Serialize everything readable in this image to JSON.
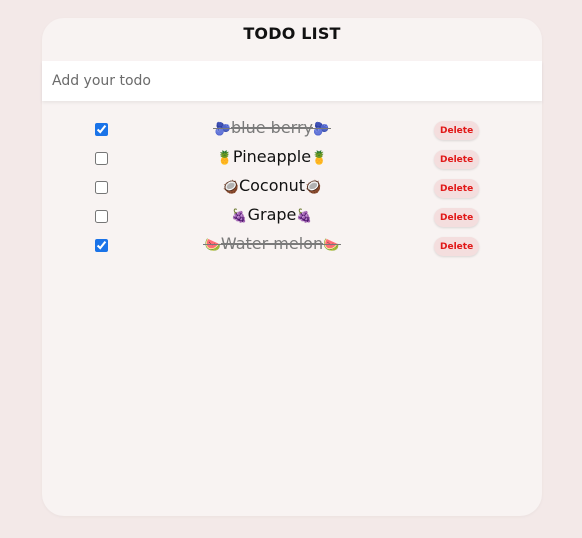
{
  "app": {
    "title": "TODO LIST"
  },
  "input": {
    "placeholder": "Add your todo",
    "value": ""
  },
  "todos": [
    {
      "left_emoji": "🫐",
      "text": "blue berry",
      "right_emoji": "🫐",
      "done": true,
      "delete_label": "Delete"
    },
    {
      "left_emoji": "🍍",
      "text": "Pineapple",
      "right_emoji": "🍍",
      "done": false,
      "delete_label": "Delete"
    },
    {
      "left_emoji": "🥥",
      "text": "Coconut",
      "right_emoji": "🥥",
      "done": false,
      "delete_label": "Delete"
    },
    {
      "left_emoji": "🍇",
      "text": "Grape",
      "right_emoji": "🍇",
      "done": false,
      "delete_label": "Delete"
    },
    {
      "left_emoji": "🍉",
      "text": "Water melon",
      "right_emoji": "🍉",
      "done": true,
      "delete_label": "Delete"
    }
  ],
  "colors": {
    "background": "#f3e9e8",
    "card": "#f8f3f2",
    "delete_text": "#e11818",
    "delete_bg": "#f4dede",
    "checkbox_accent": "#1a73e8"
  }
}
